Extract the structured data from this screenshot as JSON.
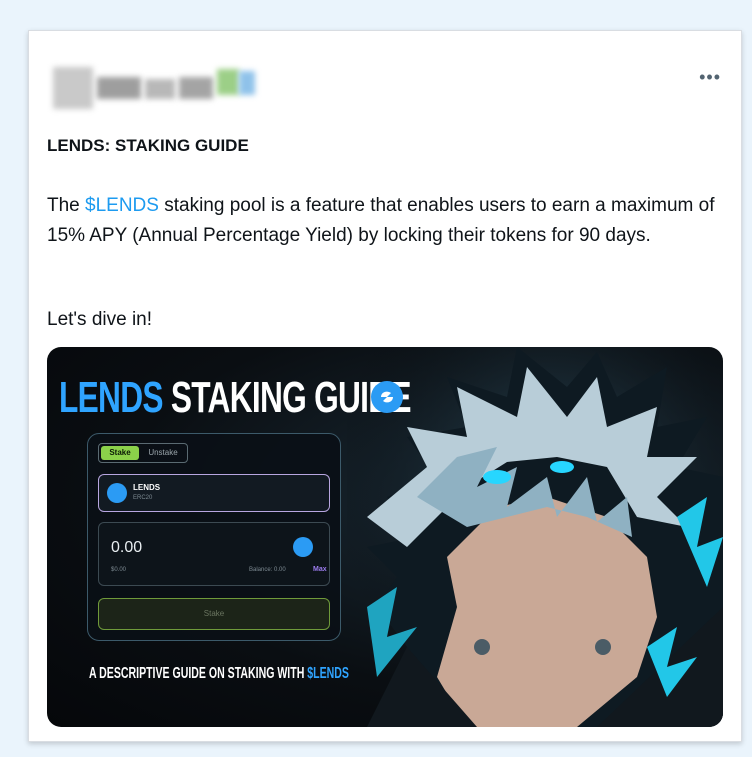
{
  "post": {
    "title": "LENDS: STAKING GUIDE",
    "body": {
      "prefix": "The ",
      "cashtag": "$LENDS",
      "suffix": " staking pool is a feature that enables users to earn a maximum of 15% APY (Annual Percentage Yield) by locking their tokens for 90 days."
    },
    "cta": "Let's dive in!",
    "more_icon": "more-horizontal-icon"
  },
  "image": {
    "title_part1": "LENDS",
    "title_part2": " STAKING GUIDE",
    "panel": {
      "tab_stake": "Stake",
      "tab_unstake": "Unstake",
      "token_name": "LENDS",
      "token_sub": "ERC20",
      "amount": "0.00",
      "usd": "$0.00",
      "balance": "Balance: 0.00",
      "max": "Max",
      "stake_button": "Stake"
    },
    "caption_part1": "A DESCRIPTIVE GUIDE ON STAKING WITH ",
    "caption_part2": "$LENDS"
  },
  "colors": {
    "accent": "#1d9bf0",
    "brand_blue": "#2fa4ff",
    "stake_green": "#8bd14a"
  }
}
